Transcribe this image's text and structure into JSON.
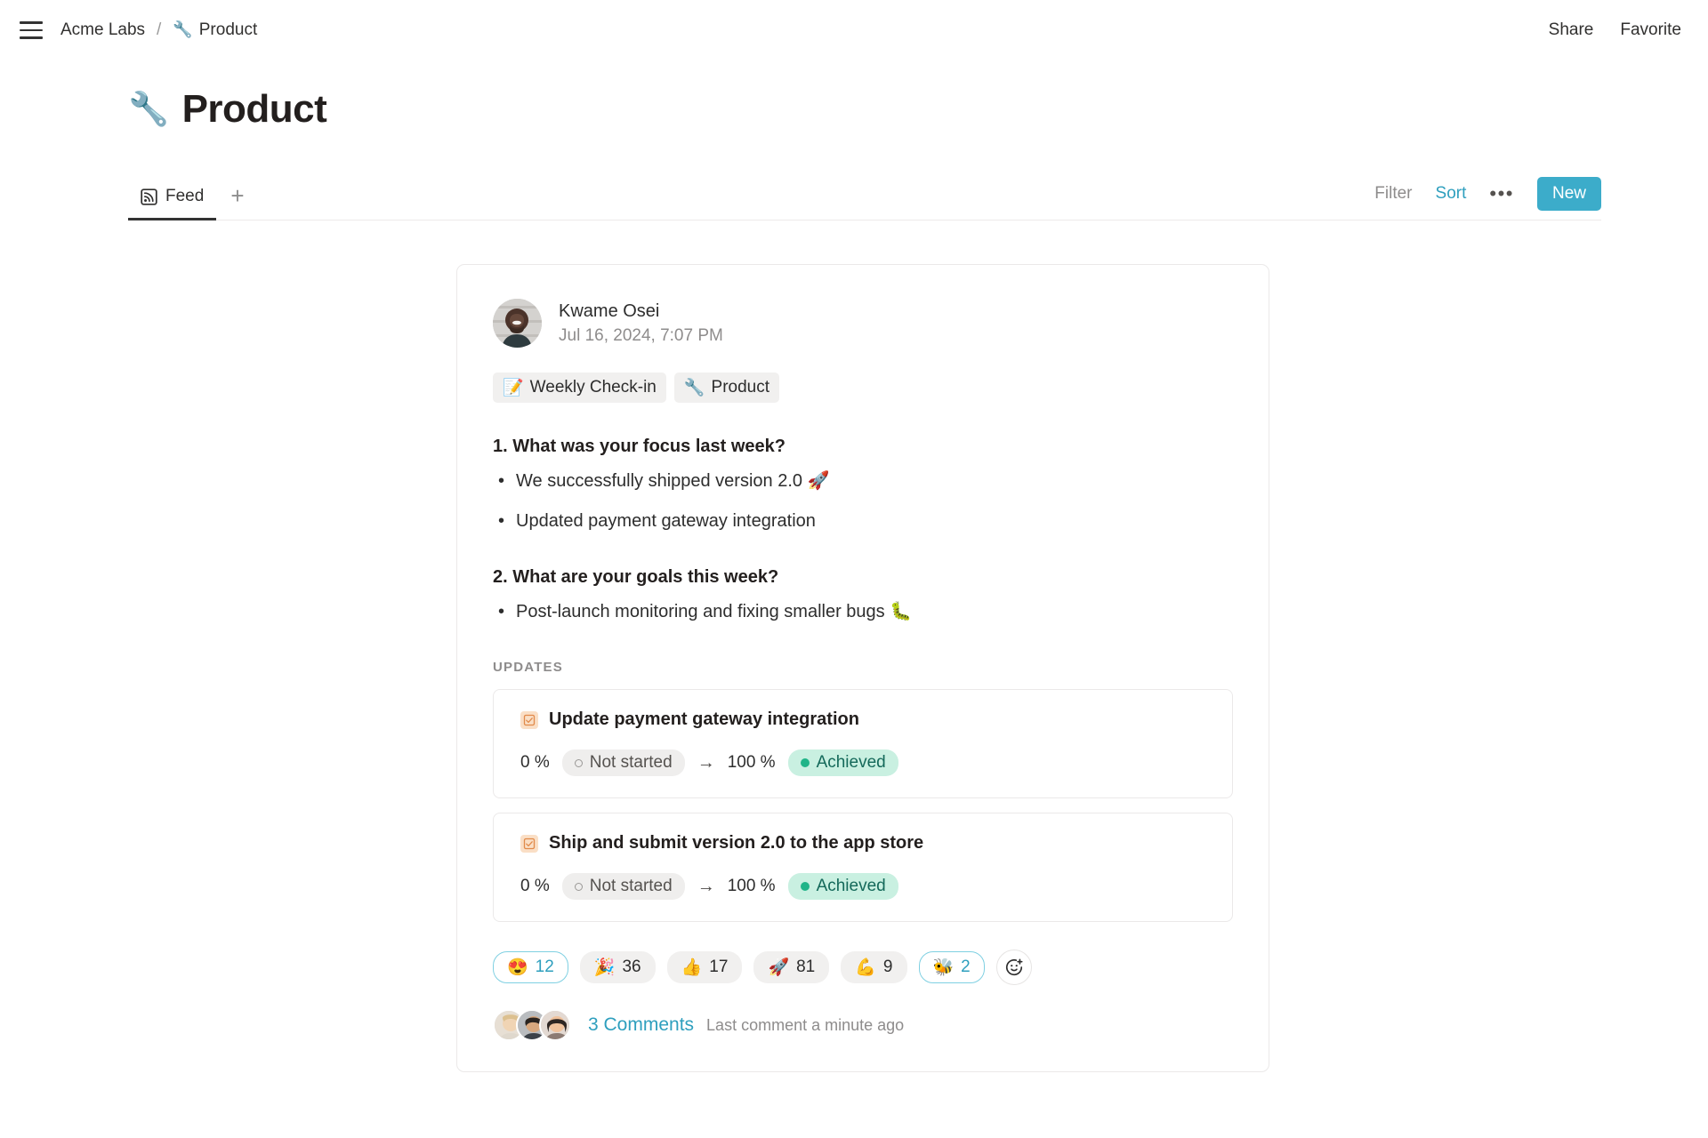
{
  "topbar": {
    "menu_icon": "hamburger-menu-icon",
    "breadcrumb": {
      "workspace": "Acme Labs",
      "separator": "/",
      "page_emoji": "🔧",
      "page": "Product"
    },
    "share_label": "Share",
    "favorite_label": "Favorite"
  },
  "page": {
    "emoji": "🔧",
    "title": "Product"
  },
  "tabs": {
    "items": [
      {
        "label": "Feed",
        "icon": "rss-feed-icon",
        "active": true
      }
    ],
    "add_tab_glyph": "+",
    "actions": {
      "filter_label": "Filter",
      "sort_label": "Sort",
      "more_glyph": "•••",
      "new_label": "New"
    }
  },
  "post": {
    "author": "Kwame Osei",
    "timestamp": "Jul 16, 2024, 7:07 PM",
    "chips": [
      {
        "emoji": "📝",
        "label": "Weekly Check-in"
      },
      {
        "emoji": "🔧",
        "label": "Product"
      }
    ],
    "questions": [
      {
        "title": "1. What was your focus last week?",
        "answers": [
          "We successfully shipped version 2.0 🚀",
          "Updated payment gateway integration"
        ]
      },
      {
        "title": "2. What are your goals this week?",
        "answers": [
          "Post-launch monitoring and fixing smaller bugs 🐛"
        ]
      }
    ],
    "updates_label": "UPDATES",
    "updates": [
      {
        "icon": "checkbox-checked-icon",
        "emoji": "🔲",
        "title": "Update payment gateway integration",
        "from_percent": "0 %",
        "from_status": "Not started",
        "arrow": "→",
        "to_percent": "100 %",
        "to_status": "Achieved"
      },
      {
        "icon": "checkbox-checked-icon",
        "emoji": "🔲",
        "title": "Ship and submit version 2.0 to the app store",
        "from_percent": "0 %",
        "from_status": "Not started",
        "arrow": "→",
        "to_percent": "100 %",
        "to_status": "Achieved"
      }
    ],
    "reactions": [
      {
        "emoji": "😍",
        "count": "12",
        "selected": true
      },
      {
        "emoji": "🎉",
        "count": "36",
        "selected": false
      },
      {
        "emoji": "👍",
        "count": "17",
        "selected": false
      },
      {
        "emoji": "🚀",
        "count": "81",
        "selected": false
      },
      {
        "emoji": "💪",
        "count": "9",
        "selected": false
      },
      {
        "emoji": "🐝",
        "count": "2",
        "selected": true
      }
    ],
    "add_reaction_icon": "add-reaction-smiley-icon",
    "comments": {
      "link_label": "3 Comments",
      "meta": "Last comment a minute ago",
      "avatar_count": 3
    }
  },
  "colors": {
    "accent_teal": "#2e9fbe",
    "new_button": "#3cacca",
    "status_achieved_bg": "#c9f0e1",
    "status_achieved_text": "#14695a",
    "status_achieved_dot": "#20b488",
    "status_notstarted_bg": "#efeeed",
    "muted_text": "#8e8c8c",
    "card_border": "#ebe9e9"
  }
}
